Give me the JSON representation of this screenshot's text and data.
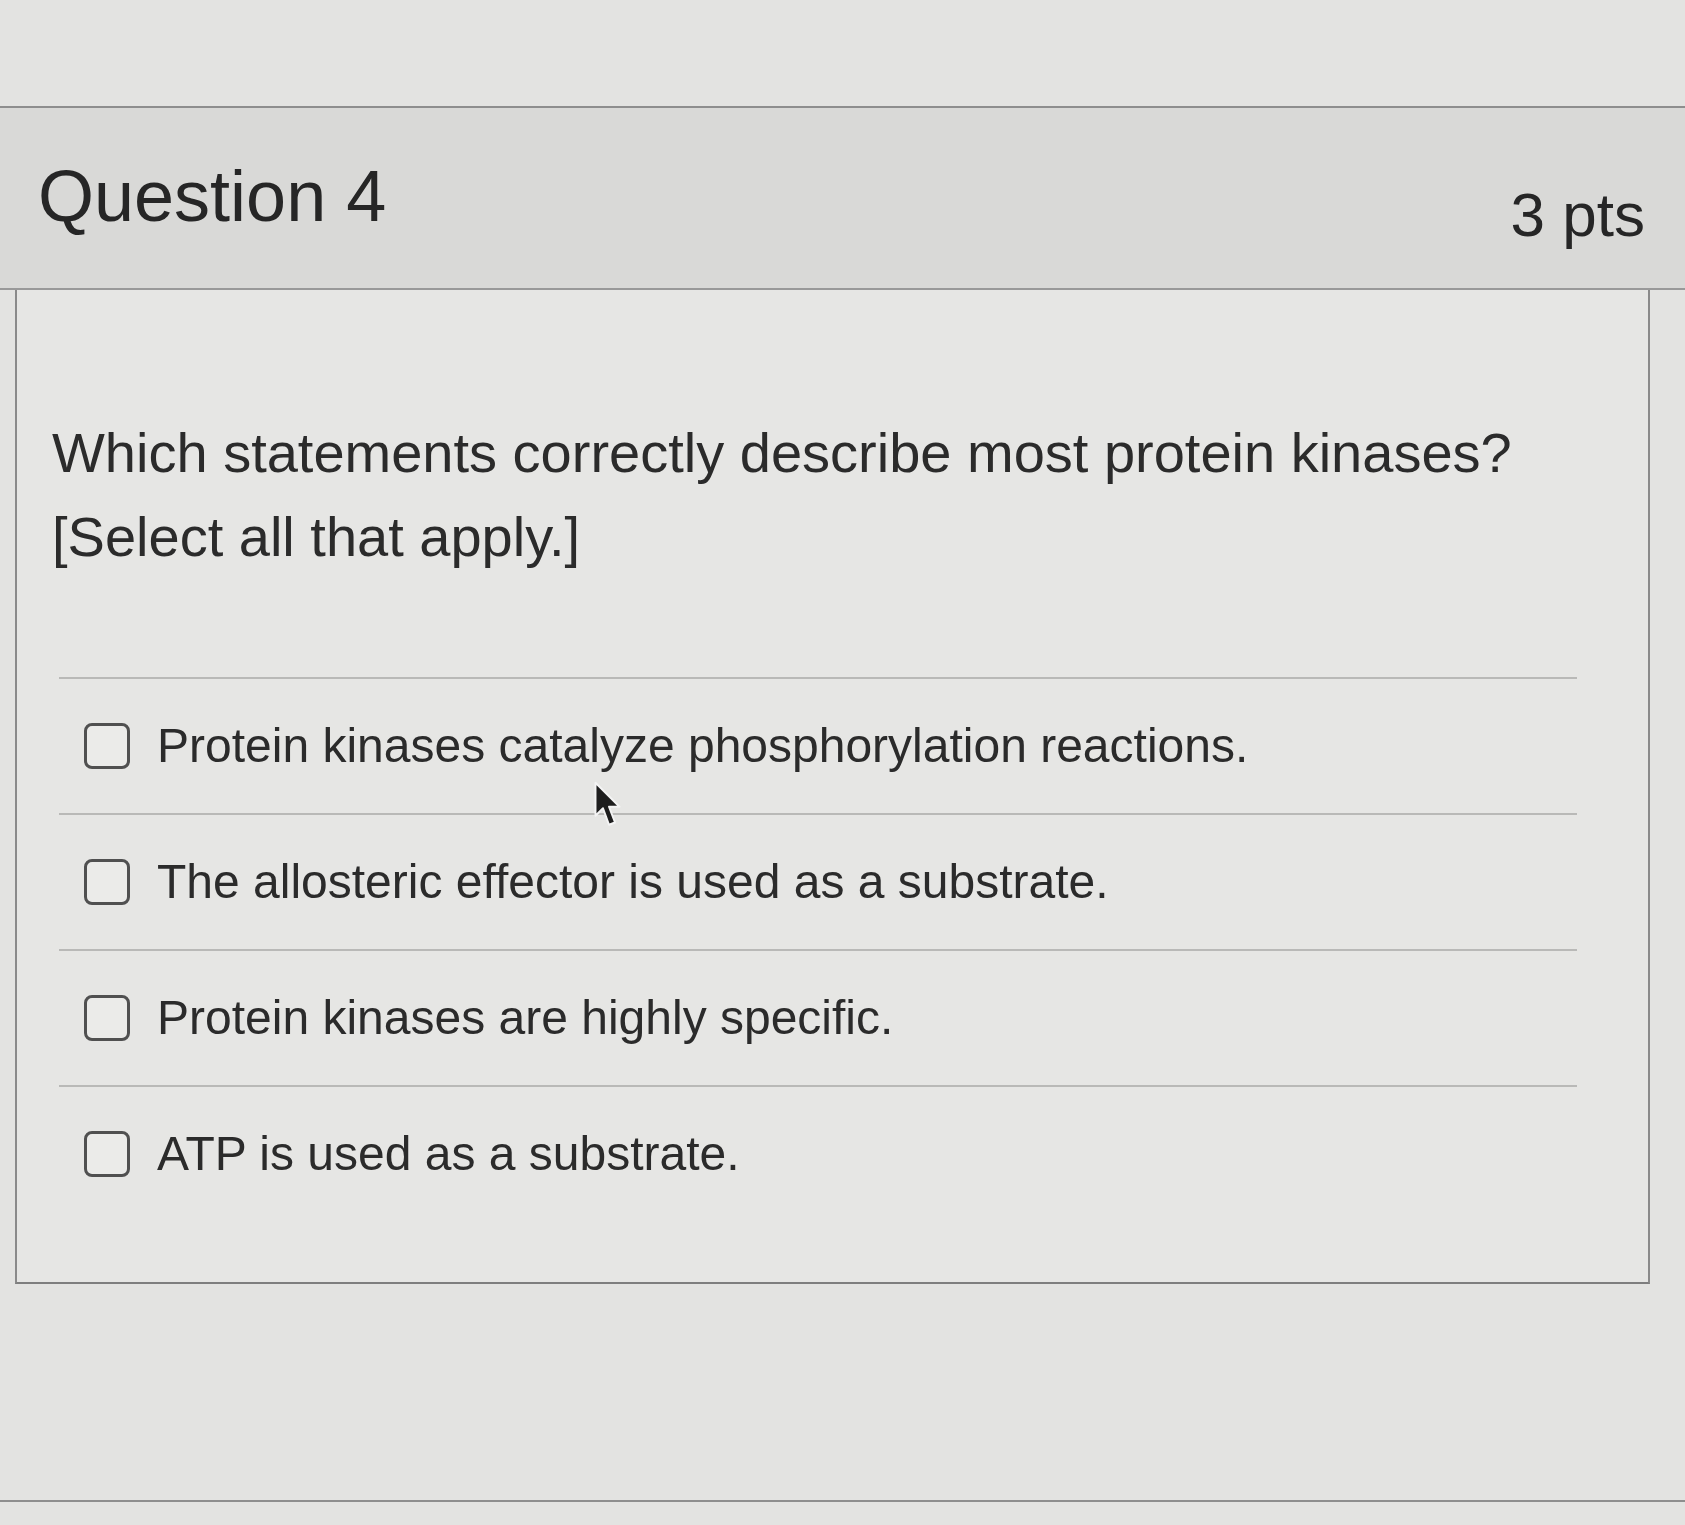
{
  "question": {
    "title": "Question 4",
    "points": "3 pts",
    "text": "Which statements correctly describe most protein kinases? [Select all that apply.]"
  },
  "answers": [
    {
      "label": "Protein kinases catalyze phosphorylation reactions.",
      "checked": false
    },
    {
      "label": "The allosteric effector is used as a substrate.",
      "checked": false
    },
    {
      "label": "Protein kinases are highly specific.",
      "checked": false
    },
    {
      "label": "ATP is used as a substrate.",
      "checked": false
    }
  ]
}
